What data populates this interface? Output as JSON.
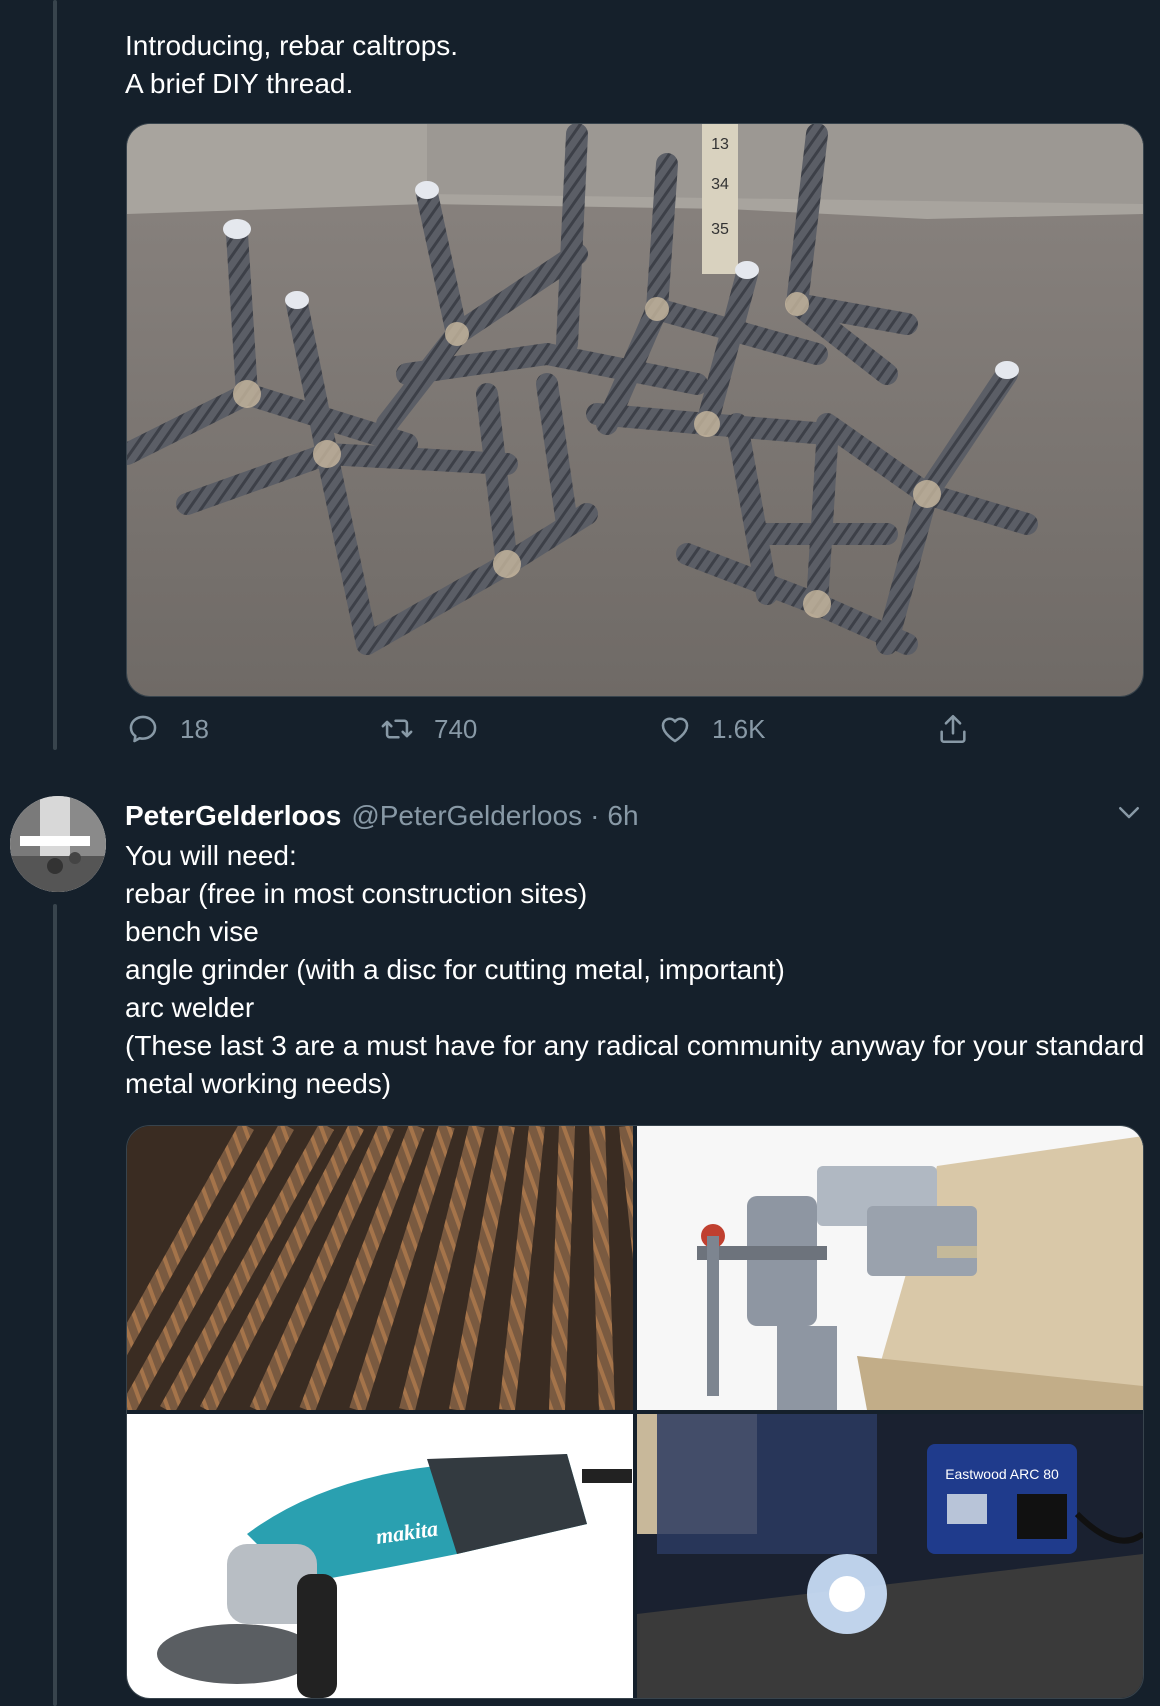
{
  "tweet1": {
    "text": "Introducing, rebar caltrops.\nA brief DIY thread.",
    "image_alt": "rebar-caltrops-photo",
    "ruler_marks": [
      "13",
      "34",
      "35"
    ],
    "actions": {
      "reply_count": "18",
      "retweet_count": "740",
      "like_count": "1.6K"
    }
  },
  "tweet2": {
    "display_name": "PeterGelderloos",
    "handle": "@PeterGelderloos",
    "separator": "·",
    "time": "6h",
    "text": "You will need:\nrebar (free in most construction sites)\nbench vise\nangle grinder (with a disc for cutting metal, important)\narc welder\n(These last 3 are a must have for any radical community anyway for your standard metal working needs)",
    "images": [
      "rebar-bundle",
      "bench-vise",
      "angle-grinder",
      "arc-welder"
    ],
    "grinder_brand": "makita",
    "welder_label": "Eastwood ARC 80"
  },
  "colors": {
    "background": "#15202b",
    "text_primary": "#ffffff",
    "text_secondary": "#8899a6",
    "border": "#38444d"
  },
  "icons": {
    "reply": "reply-icon",
    "retweet": "retweet-icon",
    "like": "heart-icon",
    "share": "share-icon",
    "more": "chevron-down-icon"
  }
}
